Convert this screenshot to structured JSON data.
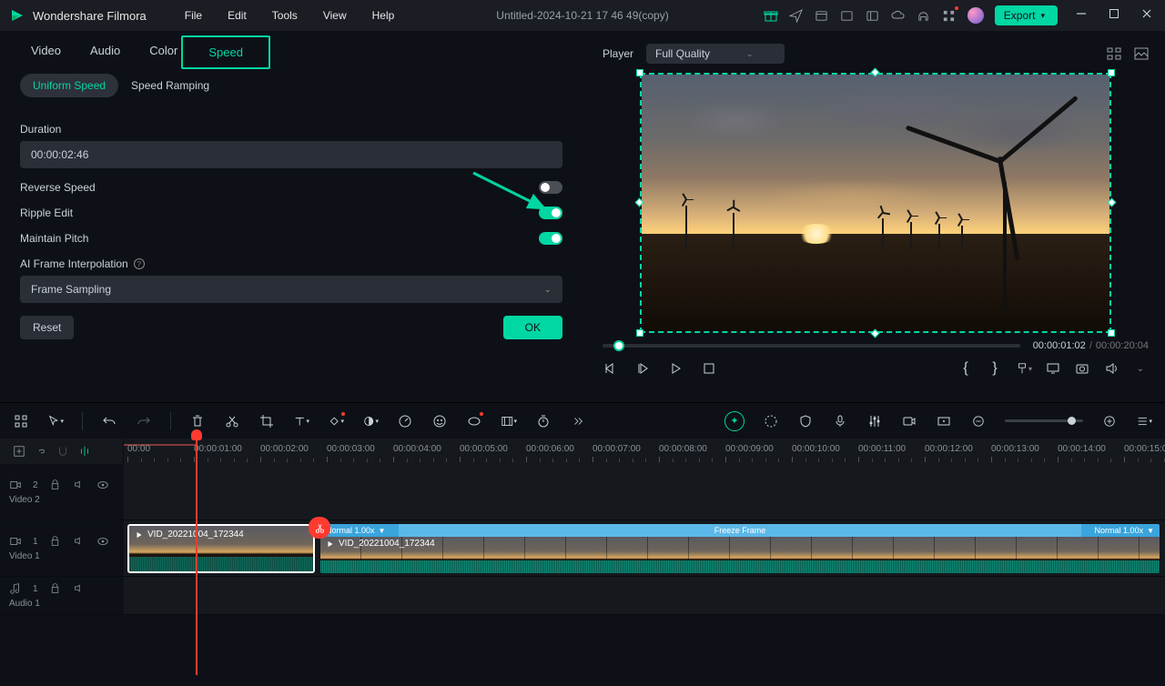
{
  "app": {
    "name": "Wondershare Filmora",
    "document": "Untitled-2024-10-21 17 46 49(copy)",
    "export_label": "Export"
  },
  "menu": {
    "file": "File",
    "edit": "Edit",
    "tools": "Tools",
    "view": "View",
    "help": "Help"
  },
  "prop_tabs": {
    "video": "Video",
    "audio": "Audio",
    "color": "Color",
    "speed": "Speed"
  },
  "sub_tabs": {
    "uniform": "Uniform Speed",
    "ramping": "Speed Ramping"
  },
  "form": {
    "duration_label": "Duration",
    "duration_value": "00:00:02:46",
    "reverse_speed": "Reverse Speed",
    "ripple_edit": "Ripple Edit",
    "maintain_pitch": "Maintain Pitch",
    "ai_interp": "AI Frame Interpolation",
    "interp_value": "Frame Sampling",
    "reset": "Reset",
    "ok": "OK"
  },
  "player": {
    "label": "Player",
    "quality": "Full Quality",
    "current_time": "00:00:01:02",
    "total_time": "00:00:20:04"
  },
  "timeline": {
    "ticks": [
      "00:00",
      "00:00:01:00",
      "00:00:02:00",
      "00:00:03:00",
      "00:00:04:00",
      "00:00:05:00",
      "00:00:06:00",
      "00:00:07:00",
      "00:00:08:00",
      "00:00:09:00",
      "00:00:10:00",
      "00:00:11:00",
      "00:00:12:00",
      "00:00:13:00",
      "00:00:14:00",
      "00:00:15:00"
    ],
    "tracks": {
      "video2": {
        "icon_label": "2",
        "name": "Video 2"
      },
      "video1": {
        "icon_label": "1",
        "name": "Video 1"
      },
      "audio1": {
        "icon_label": "1",
        "name": "Audio 1"
      }
    },
    "clip1_name": "VID_20221004_172344",
    "clip2_name": "VID_20221004_172344",
    "clip2_left": "Normal 1.00x",
    "clip2_center": "Freeze Frame",
    "clip2_right": "Normal 1.00x"
  }
}
